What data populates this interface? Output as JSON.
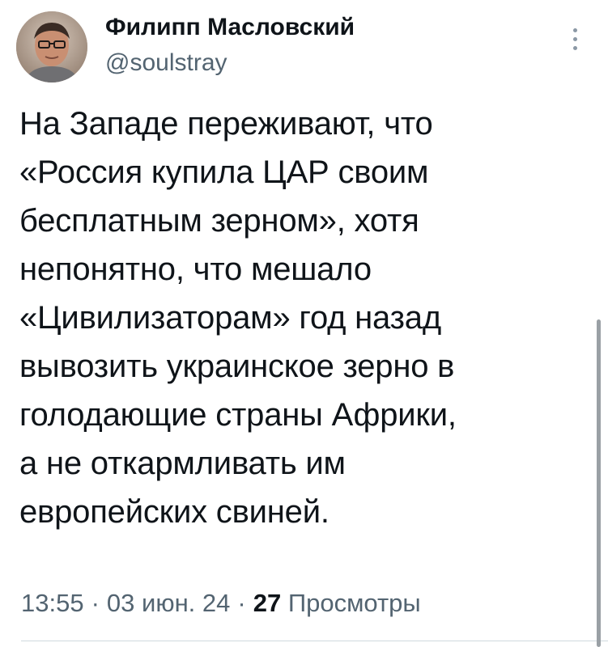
{
  "author": {
    "display_name": "Филипп Масловский",
    "handle": "@soulstray"
  },
  "tweet": {
    "lines": [
      "На Западе переживают, что",
      "«Россия купила ЦАР своим",
      "бесплатным зерном», хотя",
      "непонятно, что мешало",
      "«Цивилизаторам» год назад",
      "вывозить украинское зерно в",
      "голодающие страны Африки,",
      "а не откармливать им",
      "европейских свиней."
    ]
  },
  "meta": {
    "time": "13:55",
    "date": "03 июн. 24",
    "separator": "·",
    "views_count": "27",
    "views_label": "Просмотры"
  },
  "icons": {
    "avatar": "user-avatar-photo",
    "menu": "more-vertical-icon"
  }
}
